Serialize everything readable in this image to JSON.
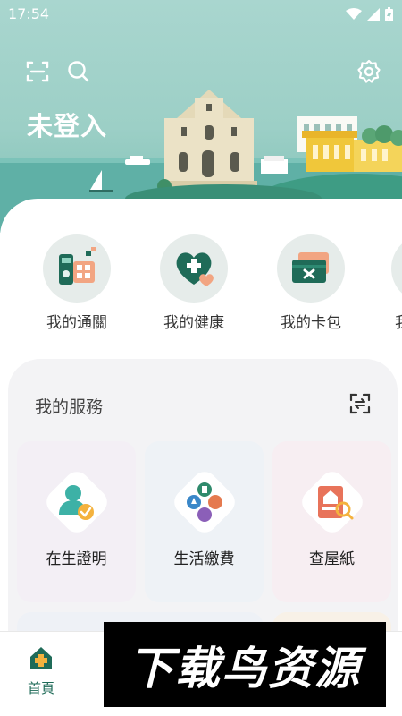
{
  "status_bar": {
    "time": "17:54"
  },
  "header": {
    "title": "未登入",
    "icons": [
      "scan-icon",
      "search-icon",
      "gear-icon"
    ]
  },
  "quick_actions": [
    {
      "label": "我的通關",
      "icon": "customs-icon"
    },
    {
      "label": "我的健康",
      "icon": "health-icon"
    },
    {
      "label": "我的卡包",
      "icon": "wallet-icon"
    },
    {
      "label": "我",
      "icon": "more-icon"
    }
  ],
  "services": {
    "title": "我的服務",
    "items": [
      {
        "label": "在生證明",
        "icon": "proof-of-life-icon",
        "bg": "#f3eff5"
      },
      {
        "label": "生活繳費",
        "icon": "bill-payment-icon",
        "bg": "#eef2f6"
      },
      {
        "label": "查屋紙",
        "icon": "property-search-icon",
        "bg": "#f7eef2"
      }
    ]
  },
  "bottom_nav": {
    "home_label": "首頁"
  },
  "watermark": {
    "text": "下载鸟资源"
  },
  "colors": {
    "brand": "#1f6b58",
    "accent": "#f4b23e",
    "hero": "#a9d6cf"
  }
}
